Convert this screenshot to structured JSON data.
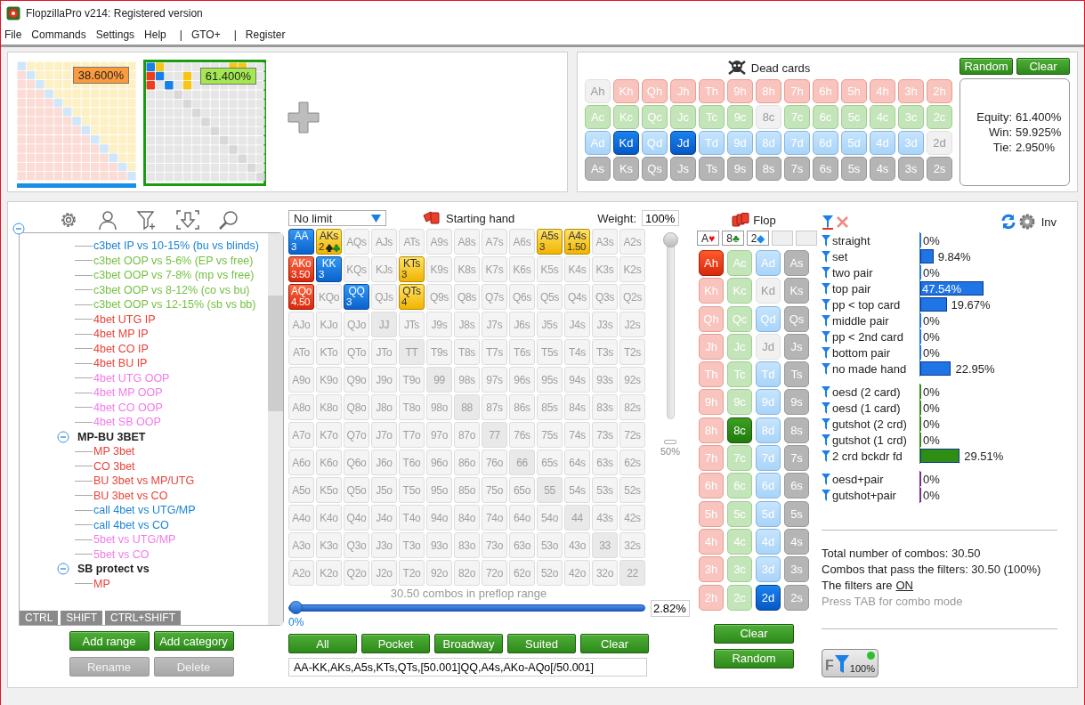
{
  "window": {
    "title": "FlopzillaPro v214: Registered version"
  },
  "menu": [
    {
      "label": "File"
    },
    {
      "label": "Commands"
    },
    {
      "label": "Settings"
    },
    {
      "label": "Help"
    },
    {
      "label": "|",
      "kind": "separator"
    },
    {
      "label": "GTO+"
    },
    {
      "label": "|",
      "kind": "separator"
    },
    {
      "label": "Register"
    }
  ],
  "range_thumbnails": [
    {
      "kind": "other",
      "equity": "38.600%",
      "color": "#fb9b3e",
      "selected": false,
      "hero": true
    },
    {
      "kind": "current",
      "equity": "61.400%",
      "color": "#a3e84f",
      "selected": true,
      "hero": false
    }
  ],
  "dead_cards": {
    "title": "Dead cards",
    "buttons": [
      "Random",
      "Clear"
    ],
    "rows": [
      {
        "kind": "hearts",
        "cards": [
          {
            "card": "Ah",
            "selected": false,
            "disabled": true
          },
          {
            "card": "Kh",
            "selected": false,
            "disabled": false
          },
          {
            "card": "Qh",
            "selected": false,
            "disabled": false
          },
          {
            "card": "Jh",
            "selected": false,
            "disabled": false
          },
          {
            "card": "Th",
            "selected": false,
            "disabled": false
          },
          {
            "card": "9h",
            "selected": false,
            "disabled": false
          },
          {
            "card": "8h",
            "selected": false,
            "disabled": false
          },
          {
            "card": "7h",
            "selected": false,
            "disabled": false
          },
          {
            "card": "6h",
            "selected": false,
            "disabled": false
          },
          {
            "card": "5h",
            "selected": false,
            "disabled": false
          },
          {
            "card": "4h",
            "selected": false,
            "disabled": false
          },
          {
            "card": "3h",
            "selected": false,
            "disabled": false
          },
          {
            "card": "2h",
            "selected": false,
            "disabled": false
          }
        ]
      },
      {
        "kind": "clubs",
        "cards": [
          {
            "card": "Ac",
            "selected": false,
            "disabled": false
          },
          {
            "card": "Kc",
            "selected": false,
            "disabled": false
          },
          {
            "card": "Qc",
            "selected": false,
            "disabled": false
          },
          {
            "card": "Jc",
            "selected": false,
            "disabled": false
          },
          {
            "card": "Tc",
            "selected": false,
            "disabled": false
          },
          {
            "card": "9c",
            "selected": false,
            "disabled": false
          },
          {
            "card": "8c",
            "selected": false,
            "disabled": true
          },
          {
            "card": "7c",
            "selected": false,
            "disabled": false
          },
          {
            "card": "6c",
            "selected": false,
            "disabled": false
          },
          {
            "card": "5c",
            "selected": false,
            "disabled": false
          },
          {
            "card": "4c",
            "selected": false,
            "disabled": false
          },
          {
            "card": "3c",
            "selected": false,
            "disabled": false
          },
          {
            "card": "2c",
            "selected": false,
            "disabled": false
          }
        ]
      },
      {
        "kind": "diamonds",
        "cards": [
          {
            "card": "Ad",
            "selected": false,
            "disabled": false
          },
          {
            "card": "Kd",
            "selected": true,
            "disabled": false
          },
          {
            "card": "Qd",
            "selected": false,
            "disabled": false
          },
          {
            "card": "Jd",
            "selected": true,
            "disabled": false
          },
          {
            "card": "Td",
            "selected": false,
            "disabled": false
          },
          {
            "card": "9d",
            "selected": false,
            "disabled": false
          },
          {
            "card": "8d",
            "selected": false,
            "disabled": false
          },
          {
            "card": "7d",
            "selected": false,
            "disabled": false
          },
          {
            "card": "6d",
            "selected": false,
            "disabled": false
          },
          {
            "card": "5d",
            "selected": false,
            "disabled": false
          },
          {
            "card": "4d",
            "selected": false,
            "disabled": false
          },
          {
            "card": "3d",
            "selected": false,
            "disabled": false
          },
          {
            "card": "2d",
            "selected": false,
            "disabled": true
          }
        ]
      },
      {
        "kind": "spades",
        "cards": [
          {
            "card": "As",
            "selected": false,
            "disabled": false
          },
          {
            "card": "Ks",
            "selected": false,
            "disabled": false
          },
          {
            "card": "Qs",
            "selected": false,
            "disabled": false
          },
          {
            "card": "Js",
            "selected": false,
            "disabled": false
          },
          {
            "card": "Ts",
            "selected": false,
            "disabled": false
          },
          {
            "card": "9s",
            "selected": false,
            "disabled": false
          },
          {
            "card": "8s",
            "selected": false,
            "disabled": false
          },
          {
            "card": "7s",
            "selected": false,
            "disabled": false
          },
          {
            "card": "6s",
            "selected": false,
            "disabled": false
          },
          {
            "card": "5s",
            "selected": false,
            "disabled": false
          },
          {
            "card": "4s",
            "selected": false,
            "disabled": false
          },
          {
            "card": "3s",
            "selected": false,
            "disabled": false
          },
          {
            "card": "2s",
            "selected": false,
            "disabled": false
          }
        ]
      }
    ]
  },
  "equity": [
    {
      "label": "Equity:",
      "value": "61.400%"
    },
    {
      "label": "Win:",
      "value": "59.925%"
    },
    {
      "label": "Tie:",
      "value": "2.950%"
    }
  ],
  "tree": {
    "nodes": [
      {
        "expanded": true,
        "children": [
          {
            "children": [
              {
                "label": "c3bet IP vs 10-15% (bu vs blinds)",
                "color": "#1b84d4"
              },
              {
                "label": "c3bet OOP vs 5-6% (EP vs free)",
                "color": "#76c043"
              },
              {
                "label": "c3bet OOP vs 7-8% (mp vs free)",
                "color": "#76c043"
              },
              {
                "label": "c3bet OOP vs 8-12% (co vs bu)",
                "color": "#76c043"
              },
              {
                "label": "c3bet OOP vs 12-15% (sb vs bb)",
                "color": "#76c043"
              },
              {
                "label": "4bet UTG IP",
                "color": "#e8433a"
              },
              {
                "label": "4bet MP IP",
                "color": "#e8433a"
              },
              {
                "label": "4bet CO IP",
                "color": "#e8433a"
              },
              {
                "label": "4bet BU IP",
                "color": "#e8433a"
              },
              {
                "label": "4bet UTG OOP",
                "color": "#f27be9"
              },
              {
                "label": "4bet MP OOP",
                "color": "#f27be9"
              },
              {
                "label": "4bet CO OOP",
                "color": "#f27be9"
              },
              {
                "label": "4bet SB OOP",
                "color": "#f27be9"
              }
            ]
          },
          {
            "label": "MP-BU 3BET",
            "expanded": true,
            "children": [
              {
                "label": "MP 3bet",
                "color": "#e8433a"
              },
              {
                "label": "CO 3bet",
                "color": "#e8433a"
              },
              {
                "label": "BU 3bet vs MP/UTG",
                "color": "#e8433a"
              },
              {
                "label": "BU 3bet vs CO",
                "color": "#e8433a"
              },
              {
                "label": "call 4bet vs UTG/MP",
                "color": "#1b84d4"
              },
              {
                "label": "call 4bet vs CO",
                "color": "#1b84d4"
              },
              {
                "label": "5bet vs UTG/MP",
                "color": "#f27be9"
              },
              {
                "label": "5bet vs CO",
                "color": "#f27be9"
              }
            ]
          },
          {
            "label": "SB protect vs",
            "expanded": true,
            "children": [
              {
                "label": "MP",
                "color": "#e8433a"
              }
            ]
          }
        ]
      }
    ],
    "keys": [
      "CTRL",
      "SHIFT",
      "CTRL+SHIFT"
    ],
    "buttons": [
      {
        "label": "Add range",
        "disabled": false
      },
      {
        "label": "Add category",
        "disabled": false
      },
      {
        "label": "Rename",
        "disabled": true
      },
      {
        "label": "Delete",
        "disabled": true
      }
    ]
  },
  "range": {
    "game": "No limit",
    "title": "Starting hand",
    "weight_label": "Weight:",
    "weight": "100%",
    "weight_slider": {
      "level": 1,
      "mark": "50%"
    },
    "hand_grid": [
      [
        {
          "hand": "AA",
          "selected": true,
          "weight": "3"
        },
        {
          "hand": "AKs",
          "selected": true,
          "weight": "2",
          "suit_filter": true
        },
        {
          "hand": "AQs",
          "selected": false
        },
        {
          "hand": "AJs",
          "selected": false
        },
        {
          "hand": "ATs",
          "selected": false
        },
        {
          "hand": "A9s",
          "selected": false
        },
        {
          "hand": "A8s",
          "selected": false
        },
        {
          "hand": "A7s",
          "selected": false
        },
        {
          "hand": "A6s",
          "selected": false
        },
        {
          "hand": "A5s",
          "selected": true,
          "weight": "3"
        },
        {
          "hand": "A4s",
          "selected": true,
          "weight": "1.50"
        },
        {
          "hand": "A3s",
          "selected": false
        },
        {
          "hand": "A2s",
          "selected": false
        }
      ],
      [
        {
          "hand": "AKo",
          "selected": true,
          "weight": "3.50"
        },
        {
          "hand": "KK",
          "selected": true,
          "weight": "3"
        },
        {
          "hand": "KQs",
          "selected": false
        },
        {
          "hand": "KJs",
          "selected": false
        },
        {
          "hand": "KTs",
          "selected": true,
          "weight": "3"
        },
        {
          "hand": "K9s",
          "selected": false
        },
        {
          "hand": "K8s",
          "selected": false
        },
        {
          "hand": "K7s",
          "selected": false
        },
        {
          "hand": "K6s",
          "selected": false
        },
        {
          "hand": "K5s",
          "selected": false
        },
        {
          "hand": "K4s",
          "selected": false
        },
        {
          "hand": "K3s",
          "selected": false
        },
        {
          "hand": "K2s",
          "selected": false
        }
      ],
      [
        {
          "hand": "AQo",
          "selected": true,
          "weight": "4.50"
        },
        {
          "hand": "KQo",
          "selected": false
        },
        {
          "hand": "QQ",
          "selected": true,
          "weight": "3"
        },
        {
          "hand": "QJs",
          "selected": false
        },
        {
          "hand": "QTs",
          "selected": true,
          "weight": "4"
        },
        {
          "hand": "Q9s",
          "selected": false
        },
        {
          "hand": "Q8s",
          "selected": false
        },
        {
          "hand": "Q7s",
          "selected": false
        },
        {
          "hand": "Q6s",
          "selected": false
        },
        {
          "hand": "Q5s",
          "selected": false
        },
        {
          "hand": "Q4s",
          "selected": false
        },
        {
          "hand": "Q3s",
          "selected": false
        },
        {
          "hand": "Q2s",
          "selected": false
        }
      ],
      [
        {
          "hand": "AJo",
          "selected": false
        },
        {
          "hand": "KJo",
          "selected": false
        },
        {
          "hand": "QJo",
          "selected": false
        },
        {
          "hand": "JJ",
          "selected": false
        },
        {
          "hand": "JTs",
          "selected": false
        },
        {
          "hand": "J9s",
          "selected": false
        },
        {
          "hand": "J8s",
          "selected": false
        },
        {
          "hand": "J7s",
          "selected": false
        },
        {
          "hand": "J6s",
          "selected": false
        },
        {
          "hand": "J5s",
          "selected": false
        },
        {
          "hand": "J4s",
          "selected": false
        },
        {
          "hand": "J3s",
          "selected": false
        },
        {
          "hand": "J2s",
          "selected": false
        }
      ],
      [
        {
          "hand": "ATo",
          "selected": false
        },
        {
          "hand": "KTo",
          "selected": false
        },
        {
          "hand": "QTo",
          "selected": false
        },
        {
          "hand": "JTo",
          "selected": false
        },
        {
          "hand": "TT",
          "selected": false
        },
        {
          "hand": "T9s",
          "selected": false
        },
        {
          "hand": "T8s",
          "selected": false
        },
        {
          "hand": "T7s",
          "selected": false
        },
        {
          "hand": "T6s",
          "selected": false
        },
        {
          "hand": "T5s",
          "selected": false
        },
        {
          "hand": "T4s",
          "selected": false
        },
        {
          "hand": "T3s",
          "selected": false
        },
        {
          "hand": "T2s",
          "selected": false
        }
      ],
      [
        {
          "hand": "A9o",
          "selected": false
        },
        {
          "hand": "K9o",
          "selected": false
        },
        {
          "hand": "Q9o",
          "selected": false
        },
        {
          "hand": "J9o",
          "selected": false
        },
        {
          "hand": "T9o",
          "selected": false
        },
        {
          "hand": "99",
          "selected": false
        },
        {
          "hand": "98s",
          "selected": false
        },
        {
          "hand": "97s",
          "selected": false
        },
        {
          "hand": "96s",
          "selected": false
        },
        {
          "hand": "95s",
          "selected": false
        },
        {
          "hand": "94s",
          "selected": false
        },
        {
          "hand": "93s",
          "selected": false
        },
        {
          "hand": "92s",
          "selected": false
        }
      ],
      [
        {
          "hand": "A8o",
          "selected": false
        },
        {
          "hand": "K8o",
          "selected": false
        },
        {
          "hand": "Q8o",
          "selected": false
        },
        {
          "hand": "J8o",
          "selected": false
        },
        {
          "hand": "T8o",
          "selected": false
        },
        {
          "hand": "98o",
          "selected": false
        },
        {
          "hand": "88",
          "selected": false
        },
        {
          "hand": "87s",
          "selected": false
        },
        {
          "hand": "86s",
          "selected": false
        },
        {
          "hand": "85s",
          "selected": false
        },
        {
          "hand": "84s",
          "selected": false
        },
        {
          "hand": "83s",
          "selected": false
        },
        {
          "hand": "82s",
          "selected": false
        }
      ],
      [
        {
          "hand": "A7o",
          "selected": false
        },
        {
          "hand": "K7o",
          "selected": false
        },
        {
          "hand": "Q7o",
          "selected": false
        },
        {
          "hand": "J7o",
          "selected": false
        },
        {
          "hand": "T7o",
          "selected": false
        },
        {
          "hand": "97o",
          "selected": false
        },
        {
          "hand": "87o",
          "selected": false
        },
        {
          "hand": "77",
          "selected": false
        },
        {
          "hand": "76s",
          "selected": false
        },
        {
          "hand": "75s",
          "selected": false
        },
        {
          "hand": "74s",
          "selected": false
        },
        {
          "hand": "73s",
          "selected": false
        },
        {
          "hand": "72s",
          "selected": false
        }
      ],
      [
        {
          "hand": "A6o",
          "selected": false
        },
        {
          "hand": "K6o",
          "selected": false
        },
        {
          "hand": "Q6o",
          "selected": false
        },
        {
          "hand": "J6o",
          "selected": false
        },
        {
          "hand": "T6o",
          "selected": false
        },
        {
          "hand": "96o",
          "selected": false
        },
        {
          "hand": "86o",
          "selected": false
        },
        {
          "hand": "76o",
          "selected": false
        },
        {
          "hand": "66",
          "selected": false
        },
        {
          "hand": "65s",
          "selected": false
        },
        {
          "hand": "64s",
          "selected": false
        },
        {
          "hand": "63s",
          "selected": false
        },
        {
          "hand": "62s",
          "selected": false
        }
      ],
      [
        {
          "hand": "A5o",
          "selected": false
        },
        {
          "hand": "K5o",
          "selected": false
        },
        {
          "hand": "Q5o",
          "selected": false
        },
        {
          "hand": "J5o",
          "selected": false
        },
        {
          "hand": "T5o",
          "selected": false
        },
        {
          "hand": "95o",
          "selected": false
        },
        {
          "hand": "85o",
          "selected": false
        },
        {
          "hand": "75o",
          "selected": false
        },
        {
          "hand": "65o",
          "selected": false
        },
        {
          "hand": "55",
          "selected": false
        },
        {
          "hand": "54s",
          "selected": false
        },
        {
          "hand": "53s",
          "selected": false
        },
        {
          "hand": "52s",
          "selected": false
        }
      ],
      [
        {
          "hand": "A4o",
          "selected": false
        },
        {
          "hand": "K4o",
          "selected": false
        },
        {
          "hand": "Q4o",
          "selected": false
        },
        {
          "hand": "J4o",
          "selected": false
        },
        {
          "hand": "T4o",
          "selected": false
        },
        {
          "hand": "94o",
          "selected": false
        },
        {
          "hand": "84o",
          "selected": false
        },
        {
          "hand": "74o",
          "selected": false
        },
        {
          "hand": "64o",
          "selected": false
        },
        {
          "hand": "54o",
          "selected": false
        },
        {
          "hand": "44",
          "selected": false
        },
        {
          "hand": "43s",
          "selected": false
        },
        {
          "hand": "42s",
          "selected": false
        }
      ],
      [
        {
          "hand": "A3o",
          "selected": false
        },
        {
          "hand": "K3o",
          "selected": false
        },
        {
          "hand": "Q3o",
          "selected": false
        },
        {
          "hand": "J3o",
          "selected": false
        },
        {
          "hand": "T3o",
          "selected": false
        },
        {
          "hand": "93o",
          "selected": false
        },
        {
          "hand": "83o",
          "selected": false
        },
        {
          "hand": "73o",
          "selected": false
        },
        {
          "hand": "63o",
          "selected": false
        },
        {
          "hand": "53o",
          "selected": false
        },
        {
          "hand": "43o",
          "selected": false
        },
        {
          "hand": "33",
          "selected": false
        },
        {
          "hand": "32s",
          "selected": false
        }
      ],
      [
        {
          "hand": "A2o",
          "selected": false
        },
        {
          "hand": "K2o",
          "selected": false
        },
        {
          "hand": "Q2o",
          "selected": false
        },
        {
          "hand": "J2o",
          "selected": false
        },
        {
          "hand": "T2o",
          "selected": false
        },
        {
          "hand": "92o",
          "selected": false
        },
        {
          "hand": "82o",
          "selected": false
        },
        {
          "hand": "72o",
          "selected": false
        },
        {
          "hand": "62o",
          "selected": false
        },
        {
          "hand": "52o",
          "selected": false
        },
        {
          "hand": "42o",
          "selected": false
        },
        {
          "hand": "32o",
          "selected": false
        },
        {
          "hand": "22",
          "selected": false
        }
      ]
    ],
    "combos_slider": {
      "label": "30.50 combos in preflop range",
      "level": 0,
      "min_label": "0%",
      "value": "2.82%"
    },
    "buttons": [
      "All",
      "Pocket",
      "Broadway",
      "Suited",
      "Clear"
    ],
    "range_text": "AA-KK,AKs,A5s,KTs,QTs,[50.001]QQ,A4s,AKo-AQo[/50.001]"
  },
  "flop": {
    "title": "Flop",
    "slots": [
      {
        "filled": true,
        "rank": "A",
        "suit_symbol": "♥",
        "kind": "hearts"
      },
      {
        "filled": true,
        "rank": "8",
        "suit_symbol": "♣",
        "kind": "clubs"
      },
      {
        "filled": true,
        "rank": "2",
        "suit_symbol": "◆",
        "kind": "diamonds"
      },
      {
        "filled": false
      },
      {
        "filled": false
      }
    ],
    "columns": [
      {
        "kind": "hearts",
        "cards": [
          {
            "card": "Ah",
            "selected": true,
            "disabled": false
          },
          {
            "card": "Kh",
            "selected": false,
            "disabled": false
          },
          {
            "card": "Qh",
            "selected": false,
            "disabled": false
          },
          {
            "card": "Jh",
            "selected": false,
            "disabled": false
          },
          {
            "card": "Th",
            "selected": false,
            "disabled": false
          },
          {
            "card": "9h",
            "selected": false,
            "disabled": false
          },
          {
            "card": "8h",
            "selected": false,
            "disabled": false
          },
          {
            "card": "7h",
            "selected": false,
            "disabled": false
          },
          {
            "card": "6h",
            "selected": false,
            "disabled": false
          },
          {
            "card": "5h",
            "selected": false,
            "disabled": false
          },
          {
            "card": "4h",
            "selected": false,
            "disabled": false
          },
          {
            "card": "3h",
            "selected": false,
            "disabled": false
          },
          {
            "card": "2h",
            "selected": false,
            "disabled": false
          }
        ]
      },
      {
        "kind": "clubs",
        "cards": [
          {
            "card": "Ac",
            "selected": false,
            "disabled": false
          },
          {
            "card": "Kc",
            "selected": false,
            "disabled": false
          },
          {
            "card": "Qc",
            "selected": false,
            "disabled": false
          },
          {
            "card": "Jc",
            "selected": false,
            "disabled": false
          },
          {
            "card": "Tc",
            "selected": false,
            "disabled": false
          },
          {
            "card": "9c",
            "selected": false,
            "disabled": false
          },
          {
            "card": "8c",
            "selected": true,
            "disabled": false
          },
          {
            "card": "7c",
            "selected": false,
            "disabled": false
          },
          {
            "card": "6c",
            "selected": false,
            "disabled": false
          },
          {
            "card": "5c",
            "selected": false,
            "disabled": false
          },
          {
            "card": "4c",
            "selected": false,
            "disabled": false
          },
          {
            "card": "3c",
            "selected": false,
            "disabled": false
          },
          {
            "card": "2c",
            "selected": false,
            "disabled": false
          }
        ]
      },
      {
        "kind": "diamonds",
        "cards": [
          {
            "card": "Ad",
            "selected": false,
            "disabled": false
          },
          {
            "card": "Kd",
            "selected": false,
            "disabled": true
          },
          {
            "card": "Qd",
            "selected": false,
            "disabled": false
          },
          {
            "card": "Jd",
            "selected": false,
            "disabled": true
          },
          {
            "card": "Td",
            "selected": false,
            "disabled": false
          },
          {
            "card": "9d",
            "selected": false,
            "disabled": false
          },
          {
            "card": "8d",
            "selected": false,
            "disabled": false
          },
          {
            "card": "7d",
            "selected": false,
            "disabled": false
          },
          {
            "card": "6d",
            "selected": false,
            "disabled": false
          },
          {
            "card": "5d",
            "selected": false,
            "disabled": false
          },
          {
            "card": "4d",
            "selected": false,
            "disabled": false
          },
          {
            "card": "3d",
            "selected": false,
            "disabled": false
          },
          {
            "card": "2d",
            "selected": true,
            "disabled": false
          }
        ]
      },
      {
        "kind": "spades",
        "cards": [
          {
            "card": "As",
            "selected": false,
            "disabled": false
          },
          {
            "card": "Ks",
            "selected": false,
            "disabled": false
          },
          {
            "card": "Qs",
            "selected": false,
            "disabled": false
          },
          {
            "card": "Js",
            "selected": false,
            "disabled": false
          },
          {
            "card": "Ts",
            "selected": false,
            "disabled": false
          },
          {
            "card": "9s",
            "selected": false,
            "disabled": false
          },
          {
            "card": "8s",
            "selected": false,
            "disabled": false
          },
          {
            "card": "7s",
            "selected": false,
            "disabled": false
          },
          {
            "card": "6s",
            "selected": false,
            "disabled": false
          },
          {
            "card": "5s",
            "selected": false,
            "disabled": false
          },
          {
            "card": "4s",
            "selected": false,
            "disabled": false
          },
          {
            "card": "3s",
            "selected": false,
            "disabled": false
          },
          {
            "card": "2s",
            "selected": false,
            "disabled": false
          }
        ]
      }
    ],
    "buttons": [
      "Clear",
      "Random"
    ]
  },
  "filters": {
    "inv_label": "Inv",
    "groups": [
      {
        "color": "#1f74e6",
        "rows": [
          {
            "label": "straight",
            "level": 0,
            "reading": "0%"
          },
          {
            "label": "set",
            "level": 0.0984,
            "reading": "9.84%"
          },
          {
            "label": "two pair",
            "level": 0,
            "reading": "0%"
          },
          {
            "label": "top pair",
            "level": 0.4754,
            "reading": "47.54%"
          },
          {
            "label": "pp < top card",
            "level": 0.1967,
            "reading": "19.67%"
          },
          {
            "label": "middle pair",
            "level": 0,
            "reading": "0%"
          },
          {
            "label": "pp < 2nd card",
            "level": 0,
            "reading": "0%"
          },
          {
            "label": "bottom pair",
            "level": 0,
            "reading": "0%"
          },
          {
            "label": "no made hand",
            "level": 0.2295,
            "reading": "22.95%"
          }
        ]
      },
      {
        "color": "#2e8e14",
        "rows": [
          {
            "label": "oesd (2 card)",
            "level": 0,
            "reading": "0%"
          },
          {
            "label": "oesd (1 card)",
            "level": 0,
            "reading": "0%"
          },
          {
            "label": "gutshot (2 crd)",
            "level": 0,
            "reading": "0%"
          },
          {
            "label": "gutshot (1 crd)",
            "level": 0,
            "reading": "0%"
          },
          {
            "label": "2 crd bckdr fd",
            "level": 0.2951,
            "reading": "29.51%"
          }
        ]
      },
      {
        "color": "#7b2a94",
        "rows": [
          {
            "label": "oesd+pair",
            "level": 0,
            "reading": "0%"
          },
          {
            "label": "gutshot+pair",
            "level": 0,
            "reading": "0%"
          }
        ]
      }
    ],
    "summary": [
      "Total number of combos: 30.50",
      "Combos that pass the filters: 30.50 (100%)"
    ],
    "filters_state_label": "The filters are",
    "filters_state": "ON",
    "hint": "Press TAB for combo mode",
    "filter_button": {
      "letter": "F",
      "reading": "100%",
      "on": true
    }
  }
}
